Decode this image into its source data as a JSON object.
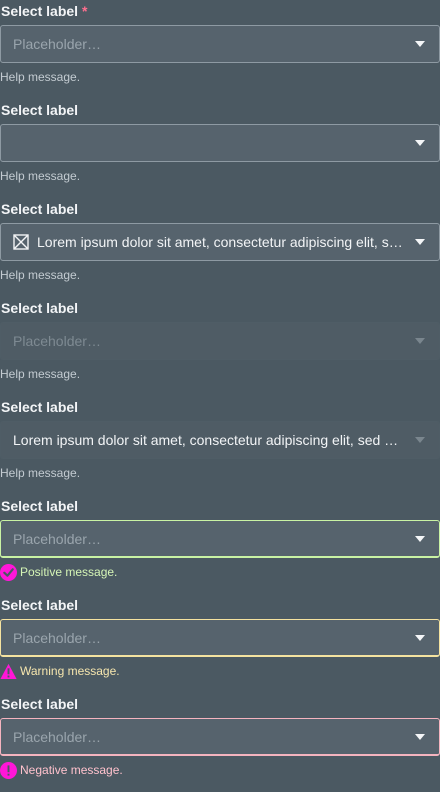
{
  "fields": [
    {
      "label": "Select label",
      "required_marker": "*",
      "placeholder": "Placeholder…",
      "help": "Help message."
    },
    {
      "label": "Select label",
      "value": "",
      "help": "Help message."
    },
    {
      "label": "Select label",
      "value": "Lorem ipsum dolor sit amet, consectetur adipiscing elit, sed do eiusmod tempor incididunt ut labore et dolore magna aliqua.",
      "icon": "clear-icon",
      "help": "Help message."
    },
    {
      "label": "Select label",
      "placeholder": "Placeholder…",
      "help": "Help message.",
      "state": "disabled"
    },
    {
      "label": "Select label",
      "value": "Lorem ipsum dolor sit amet, consectetur adipiscing elit, sed do eiusmod tempor incididunt ut labore et dolore magna aliqua.",
      "help": "Help message.",
      "state": "disabled"
    },
    {
      "label": "Select label",
      "placeholder": "Placeholder…",
      "status": "Positive message.",
      "state": "positive",
      "icon": "check-circle-icon"
    },
    {
      "label": "Select label",
      "placeholder": "Placeholder…",
      "status": "Warning message.",
      "state": "warning",
      "icon": "warning-triangle-icon"
    },
    {
      "label": "Select label",
      "placeholder": "Placeholder…",
      "status": "Negative message.",
      "state": "negative",
      "icon": "error-circle-icon"
    }
  ],
  "colors": {
    "background": "#4b5962",
    "field_background": "#56636d",
    "required": "#ff6f8f",
    "status_icon": "#ff16d8",
    "positive_border": "#c9f3a4",
    "warning_border": "#f5e3a0",
    "negative_border": "#f5b4bf"
  }
}
